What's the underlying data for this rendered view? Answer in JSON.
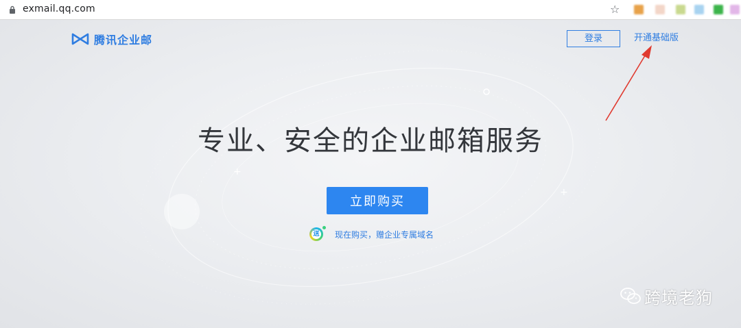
{
  "browser": {
    "url": "exmail.qq.com",
    "icons": {
      "lock": "lock-icon",
      "bookmark": "star-icon"
    },
    "extension_colors": [
      "#e8a24a",
      "#f3d6c8",
      "#c9d98f",
      "#a8d3f0",
      "#3cb44b",
      "#e2b6e8"
    ]
  },
  "header": {
    "logo_text": "腾讯企业邮",
    "logo_icon": "exmail-logo-icon",
    "login_label": "登录",
    "basic_link_label": "开通基础版"
  },
  "hero": {
    "headline": "专业、安全的企业邮箱服务",
    "buy_label": "立即购买",
    "promo_badge": "送",
    "promo_text": "现在购买，赠企业专属域名"
  },
  "watermark": {
    "text": "跨境老狗",
    "icon": "wechat-icon"
  },
  "colors": {
    "brand_blue": "#2f7de1",
    "button_blue": "#2d86f0",
    "headline": "#33363b",
    "annotation_arrow": "#e03a2f"
  }
}
